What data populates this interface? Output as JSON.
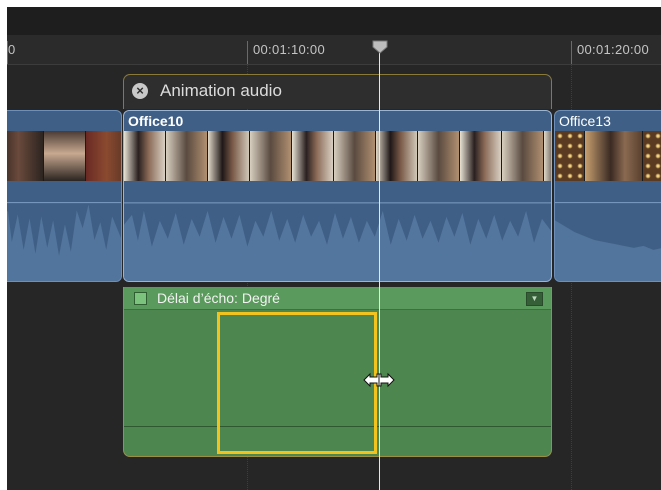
{
  "ruler": {
    "left_fragment": "0",
    "timecode_1": "00:01:10:00",
    "timecode_2": "00:01:20:00"
  },
  "animation_editor": {
    "title": "Animation audio",
    "close_icon": "close-circle-icon"
  },
  "clips": [
    {
      "name": "",
      "position": "left-partial"
    },
    {
      "name": "Office10",
      "position": "center"
    },
    {
      "name": "Office13",
      "position": "right-partial"
    }
  ],
  "effect": {
    "label": "Délai d’écho: Degré",
    "menu_icon": "disclosure-triangle-icon"
  },
  "colors": {
    "clip_blue": "#3f5f86",
    "effect_green": "#4e8650",
    "range_yellow": "#f2c21e",
    "selection_border": "#9b8f45"
  }
}
